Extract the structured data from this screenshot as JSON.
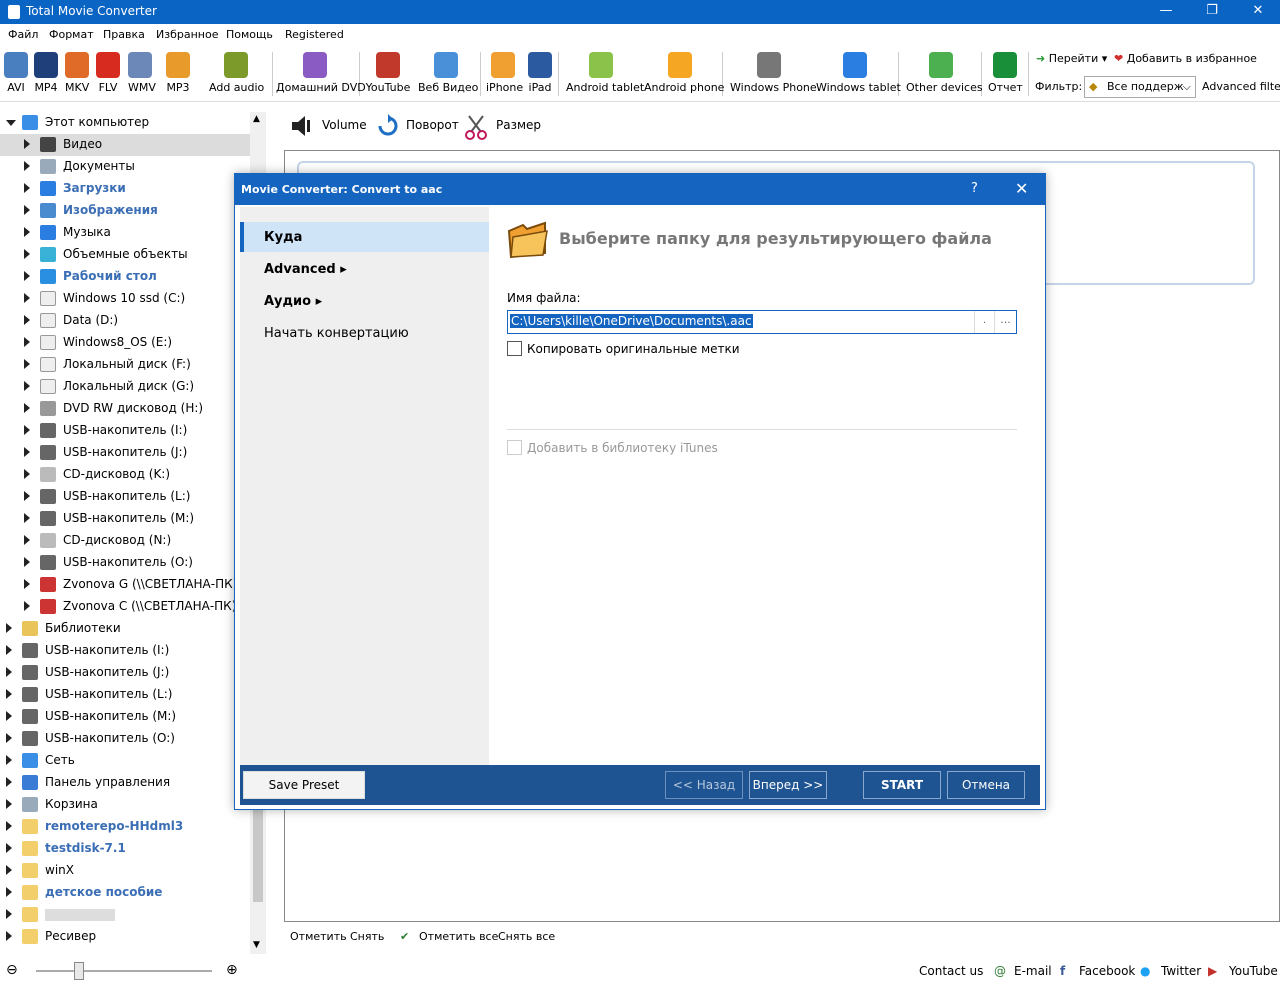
{
  "window": {
    "title": "Total Movie Converter"
  },
  "menu": [
    "Файл",
    "Формат",
    "Правка",
    "Избранное",
    "Помощь",
    "Registered"
  ],
  "toolbar": {
    "items": [
      {
        "label": "AVI",
        "color": "#4a7fbf"
      },
      {
        "label": "MP4",
        "color": "#1f3f7a"
      },
      {
        "label": "MKV",
        "color": "#e06a28"
      },
      {
        "label": "FLV",
        "color": "#d82b1f"
      },
      {
        "label": "WMV",
        "color": "#6c88b8"
      },
      {
        "label": "MP3",
        "color": "#e89a2a"
      },
      {
        "label": "Add audio",
        "color": "#7c9a2a"
      },
      {
        "label": "Домашний DVD",
        "color": "#8a5bc2"
      },
      {
        "label": "YouTube",
        "color": "#c0392b"
      },
      {
        "label": "Веб Видео",
        "color": "#4a90d9"
      },
      {
        "label": "iPhone",
        "color": "#f0a030"
      },
      {
        "label": "iPad",
        "color": "#2c5aa0"
      },
      {
        "label": "Android tablet",
        "color": "#8bc34a"
      },
      {
        "label": "Android phone",
        "color": "#f5a623"
      },
      {
        "label": "Windows Phone",
        "color": "#777777"
      },
      {
        "label": "Windows tablet",
        "color": "#2a7de1"
      },
      {
        "label": "Other devices",
        "color": "#4caf50"
      },
      {
        "label": "Отчет",
        "color": "#1a8f3a"
      }
    ],
    "goto": "Перейти",
    "add_fav": "Добавить в избранное",
    "filter_label": "Фильтр:",
    "filter_value": "Все поддерж",
    "advanced_filter": "Advanced filter"
  },
  "tree": [
    {
      "label": "Этот компьютер",
      "level": 0,
      "open": true,
      "style": "normal",
      "icon": "computer-icon"
    },
    {
      "label": "Видео",
      "level": 1,
      "selected": true,
      "style": "normal",
      "icon": "video-folder-icon"
    },
    {
      "label": "Документы",
      "level": 1,
      "style": "normal",
      "icon": "documents-icon"
    },
    {
      "label": "Загрузки",
      "level": 1,
      "style": "blue",
      "icon": "downloads-icon"
    },
    {
      "label": "Изображения",
      "level": 1,
      "style": "blue",
      "icon": "pictures-icon"
    },
    {
      "label": "Музыка",
      "level": 1,
      "style": "normal",
      "icon": "music-icon"
    },
    {
      "label": "Объемные объекты",
      "level": 1,
      "style": "normal",
      "icon": "3d-objects-icon"
    },
    {
      "label": "Рабочий стол",
      "level": 1,
      "style": "blue",
      "icon": "desktop-icon"
    },
    {
      "label": "Windows 10 ssd (C:)",
      "level": 1,
      "style": "normal",
      "icon": "drive-icon"
    },
    {
      "label": "Data (D:)",
      "level": 1,
      "style": "normal",
      "icon": "drive-icon"
    },
    {
      "label": "Windows8_OS (E:)",
      "level": 1,
      "style": "normal",
      "icon": "drive-icon"
    },
    {
      "label": "Локальный диск (F:)",
      "level": 1,
      "style": "normal",
      "icon": "drive-icon"
    },
    {
      "label": "Локальный диск (G:)",
      "level": 1,
      "style": "normal",
      "icon": "drive-icon"
    },
    {
      "label": "DVD RW дисковод (H:)",
      "level": 1,
      "style": "normal",
      "icon": "dvd-drive-icon"
    },
    {
      "label": "USB-накопитель (I:)",
      "level": 1,
      "style": "normal",
      "icon": "usb-drive-icon"
    },
    {
      "label": "USB-накопитель (J:)",
      "level": 1,
      "style": "normal",
      "icon": "usb-drive-icon"
    },
    {
      "label": "CD-дисковод (K:)",
      "level": 1,
      "style": "normal",
      "icon": "cd-drive-icon"
    },
    {
      "label": "USB-накопитель (L:)",
      "level": 1,
      "style": "normal",
      "icon": "usb-drive-icon"
    },
    {
      "label": "USB-накопитель (M:)",
      "level": 1,
      "style": "normal",
      "icon": "usb-drive-icon"
    },
    {
      "label": "CD-дисковод (N:)",
      "level": 1,
      "style": "normal",
      "icon": "cd-drive-icon"
    },
    {
      "label": "USB-накопитель (O:)",
      "level": 1,
      "style": "normal",
      "icon": "usb-drive-icon"
    },
    {
      "label": "Zvonova G (\\\\СВЕТЛАНА-ПК)",
      "level": 1,
      "style": "normal",
      "icon": "network-drive-icon"
    },
    {
      "label": "Zvonova C (\\\\СВЕТЛАНА-ПК)",
      "level": 1,
      "style": "normal",
      "icon": "network-drive-icon"
    },
    {
      "label": "Библиотеки",
      "level": 0,
      "style": "normal",
      "icon": "libraries-icon"
    },
    {
      "label": "USB-накопитель (I:)",
      "level": 0,
      "style": "normal",
      "icon": "usb-drive-icon"
    },
    {
      "label": "USB-накопитель (J:)",
      "level": 0,
      "style": "normal",
      "icon": "usb-drive-icon"
    },
    {
      "label": "USB-накопитель (L:)",
      "level": 0,
      "style": "normal",
      "icon": "usb-drive-icon"
    },
    {
      "label": "USB-накопитель (M:)",
      "level": 0,
      "style": "normal",
      "icon": "usb-drive-icon"
    },
    {
      "label": "USB-накопитель (O:)",
      "level": 0,
      "style": "normal",
      "icon": "usb-drive-icon"
    },
    {
      "label": "Сеть",
      "level": 0,
      "style": "normal",
      "icon": "network-icon"
    },
    {
      "label": "Панель управления",
      "level": 0,
      "style": "normal",
      "icon": "control-panel-icon"
    },
    {
      "label": "Корзина",
      "level": 0,
      "style": "normal",
      "icon": "recycle-bin-icon"
    },
    {
      "label": "remoterepo-HHdml3",
      "level": 0,
      "style": "blue",
      "icon": "folder-icon"
    },
    {
      "label": "testdisk-7.1",
      "level": 0,
      "style": "blue",
      "icon": "folder-icon"
    },
    {
      "label": "winX",
      "level": 0,
      "style": "normal",
      "icon": "folder-icon"
    },
    {
      "label": "детское пособие",
      "level": 0,
      "style": "blue",
      "icon": "folder-icon"
    },
    {
      "label": "",
      "level": 0,
      "style": "blurred",
      "icon": "folder-icon"
    },
    {
      "label": "Ресивер",
      "level": 0,
      "style": "normal",
      "icon": "folder-icon"
    }
  ],
  "right_toolbar": {
    "volume": "Volume",
    "rotate": "Поворот",
    "size": "Размер"
  },
  "bottom_actions": {
    "mark": "Отметить",
    "unmark": "Снять",
    "mark_all": "Отметить все",
    "unmark_all": "Снять все"
  },
  "status": {
    "contact": "Contact us",
    "email": "E-mail",
    "facebook": "Facebook",
    "twitter": "Twitter",
    "youtube": "YouTube"
  },
  "dialog": {
    "title": "Movie Converter:  Convert to aac",
    "help": "?",
    "close": "✕",
    "nav": [
      {
        "label": "Куда",
        "selected": true,
        "bold": true,
        "arrow": false
      },
      {
        "label": "Advanced",
        "bold": true,
        "arrow": true
      },
      {
        "label": "Аудио",
        "bold": true,
        "arrow": true
      },
      {
        "label": "Начать конвертацию",
        "bold": false,
        "arrow": false
      }
    ],
    "header": "Выберите папку для результирующего файла",
    "filename_label": "Имя файла:",
    "filename_value": "C:\\Users\\kille\\OneDrive\\Documents\\.aac",
    "filename_btn1": ".",
    "filename_btn2": "...",
    "copy_tags": "Копировать оригинальные метки",
    "itunes": "Добавить в библиотеку iTunes",
    "buttons": {
      "save_preset": "Save Preset",
      "back": "<< Назад",
      "next": "Вперед >>",
      "start": "START",
      "cancel": "Отмена"
    }
  }
}
